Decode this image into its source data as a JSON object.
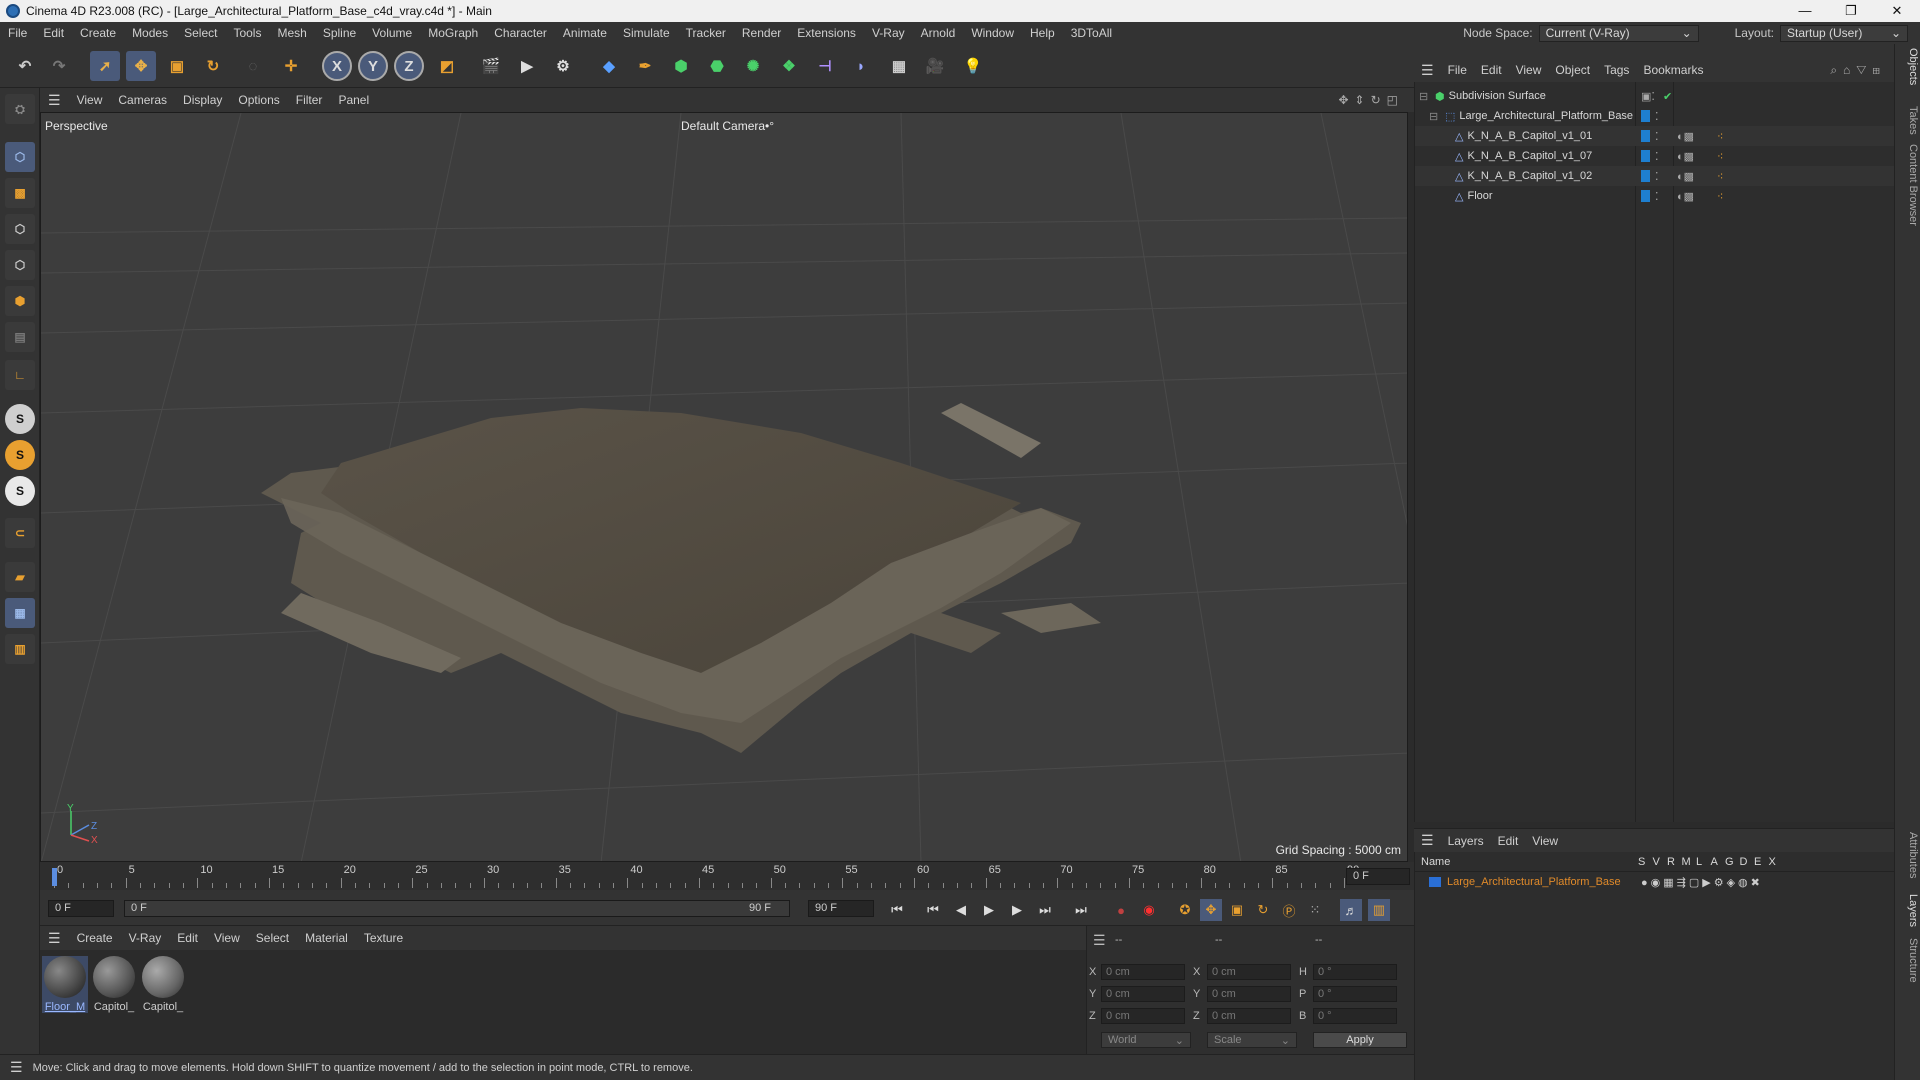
{
  "window": {
    "title": "Cinema 4D R23.008 (RC) - [Large_Architectural_Platform_Base_c4d_vray.c4d *] - Main",
    "controls": [
      "—",
      "❐",
      "✕"
    ]
  },
  "menubar": {
    "items": [
      "File",
      "Edit",
      "Create",
      "Modes",
      "Select",
      "Tools",
      "Mesh",
      "Spline",
      "Volume",
      "MoGraph",
      "Character",
      "Animate",
      "Simulate",
      "Tracker",
      "Render",
      "Extensions",
      "V-Ray",
      "Arnold",
      "Window",
      "Help",
      "3DToAll"
    ],
    "node_space_label": "Node Space:",
    "node_space_value": "Current (V-Ray)",
    "layout_label": "Layout:",
    "layout_value": "Startup (User)"
  },
  "toolbar": {
    "axis_x": "X",
    "axis_y": "Y",
    "axis_z": "Z"
  },
  "lefttools": {
    "s1": "S",
    "s2": "S",
    "s3": "S"
  },
  "viewport": {
    "menu": [
      "View",
      "Cameras",
      "Display",
      "Options",
      "Filter",
      "Panel"
    ],
    "label": "Perspective",
    "camera": "Default Camera",
    "camera_suffix": "•°",
    "grid_spacing": "Grid Spacing : 5000 cm",
    "axis_y": "Y",
    "axis_z": "Z",
    "axis_x": "X"
  },
  "timeline": {
    "ticks": [
      "0",
      "5",
      "10",
      "15",
      "20",
      "25",
      "30",
      "35",
      "40",
      "45",
      "50",
      "55",
      "60",
      "65",
      "70",
      "75",
      "80",
      "85",
      "90"
    ],
    "current_frame": "0 F",
    "start_field": "0 F",
    "range_start": "0 F",
    "range_end": "90 F",
    "end_field": "90 F"
  },
  "materials": {
    "menu": [
      "Create",
      "V-Ray",
      "Edit",
      "View",
      "Select",
      "Material",
      "Texture"
    ],
    "items": [
      {
        "name": "Floor_M"
      },
      {
        "name": "Capitol_"
      },
      {
        "name": "Capitol_"
      }
    ]
  },
  "coords": {
    "header": [
      "--",
      "--",
      "--"
    ],
    "rows": [
      {
        "l1": "X",
        "v1": "0 cm",
        "l2": "X",
        "v2": "0 cm",
        "l3": "H",
        "v3": "0 °"
      },
      {
        "l1": "Y",
        "v1": "0 cm",
        "l2": "Y",
        "v2": "0 cm",
        "l3": "P",
        "v3": "0 °"
      },
      {
        "l1": "Z",
        "v1": "0 cm",
        "l2": "Z",
        "v2": "0 cm",
        "l3": "B",
        "v3": "0 °"
      }
    ],
    "space": "World",
    "mode": "Scale",
    "apply": "Apply"
  },
  "status": "Move: Click and drag to move elements. Hold down SHIFT to quantize movement / add to the selection in point mode, CTRL to remove.",
  "objects": {
    "menu": [
      "File",
      "Edit",
      "View",
      "Object",
      "Tags",
      "Bookmarks"
    ],
    "rows": [
      {
        "name": "Subdivision Surface",
        "indent": 0
      },
      {
        "name": "Large_Architectural_Platform_Base",
        "indent": 1
      },
      {
        "name": "K_N_A_B_Capitol_v1_01",
        "indent": 2
      },
      {
        "name": "K_N_A_B_Capitol_v1_07",
        "indent": 2
      },
      {
        "name": "K_N_A_B_Capitol_v1_02",
        "indent": 2
      },
      {
        "name": "Floor",
        "indent": 2
      }
    ]
  },
  "layers": {
    "menu": [
      "Layers",
      "Edit",
      "View"
    ],
    "name_header": "Name",
    "flags": [
      "S",
      "V",
      "R",
      "M",
      "L",
      "A",
      "G",
      "D",
      "E",
      "X"
    ],
    "rows": [
      {
        "name": "Large_Architectural_Platform_Base",
        "color": "#2a6fd6"
      }
    ]
  },
  "sidetabs": [
    "Objects",
    "Takes",
    "Content Browser",
    "Attributes",
    "Layers",
    "Structure"
  ],
  "colors": {
    "accent": "#5b8de0",
    "layer_text": "#e08a2a",
    "tag_blue": "#1e7fd0"
  }
}
